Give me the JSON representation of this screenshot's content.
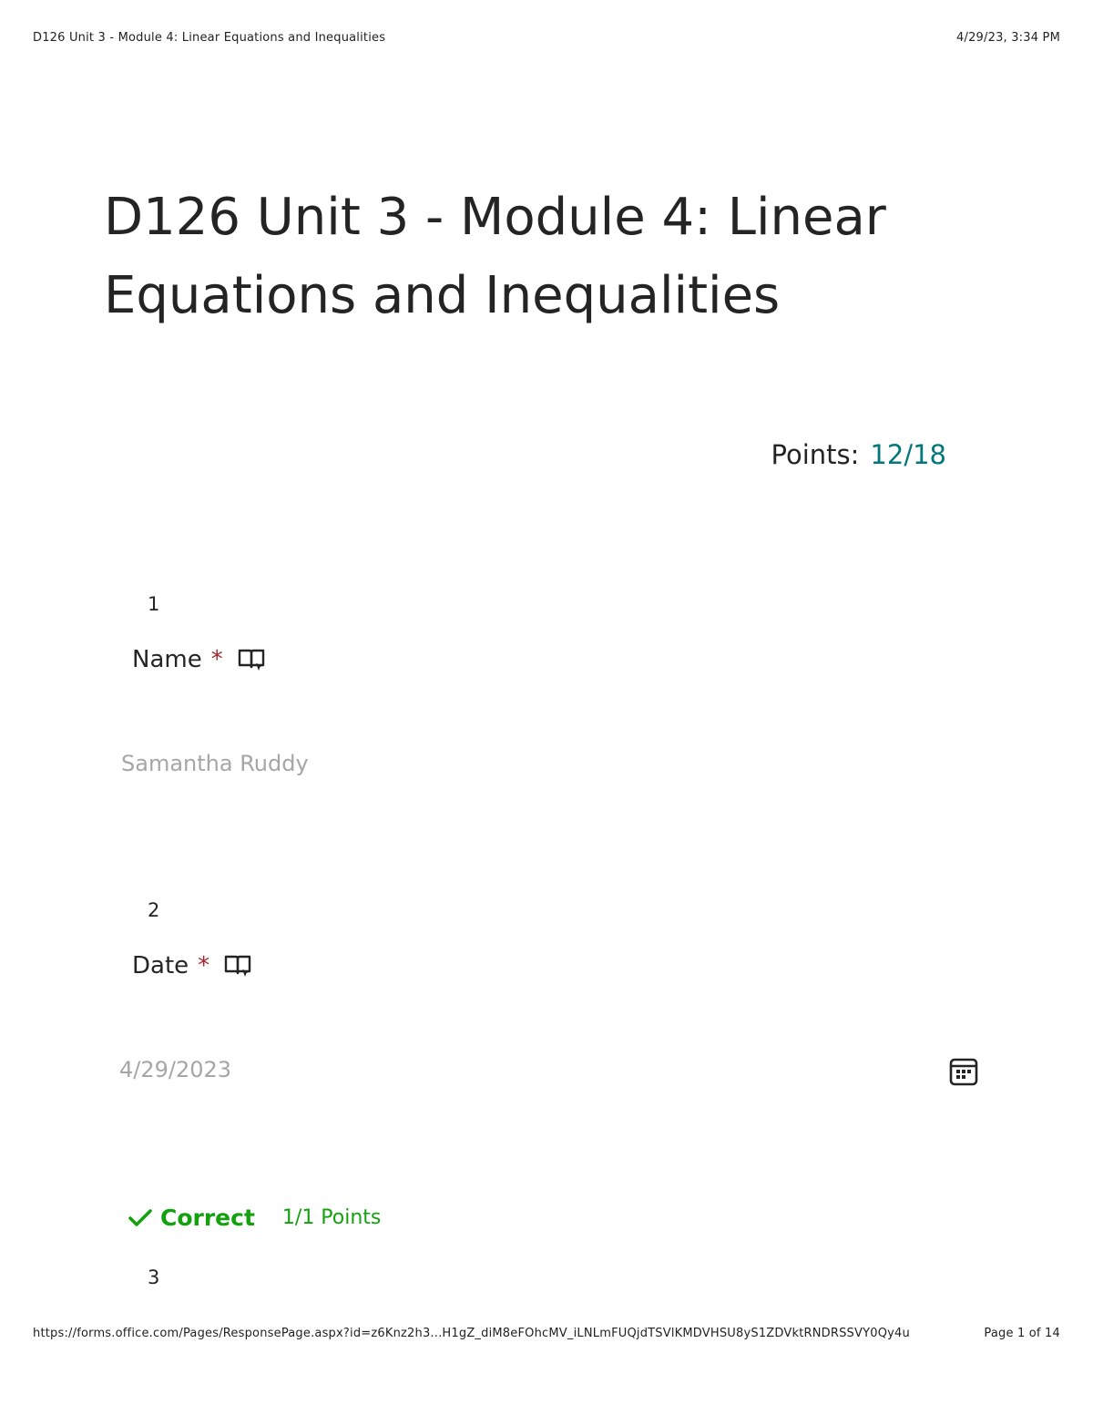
{
  "print_header": {
    "left": "D126 Unit 3 - Module 4: Linear Equations and Inequalities",
    "right": "4/29/23, 3:34 PM"
  },
  "form": {
    "title": "D126 Unit 3 - Module 4: Linear Equations and Inequalities",
    "points_label": "Points:",
    "points_value": "12/18"
  },
  "questions": [
    {
      "number": "1",
      "title": "Name",
      "required_mark": "*",
      "icon": "immersive-reader-icon",
      "answer": "Samantha Ruddy"
    },
    {
      "number": "2",
      "title": "Date",
      "required_mark": "*",
      "icon": "immersive-reader-icon",
      "answer": "4/29/2023",
      "answer_icon": "calendar-icon"
    },
    {
      "number": "3",
      "result_icon": "checkmark-icon",
      "result": "Correct",
      "result_points": "1/1 Points"
    }
  ],
  "print_footer": {
    "url": "https://forms.office.com/Pages/ResponsePage.aspx?id=z6Knz2h3...H1gZ_diM8eFOhcMV_iLNLmFUQjdTSVlKMDVHSU8yS1ZDVktRNDRSSVY0Qy4u",
    "page": "Page 1 of 14"
  },
  "colors": {
    "score": "#03787c",
    "required": "#a4262c",
    "correct": "#13a10e",
    "answer_text": "#a6a6a6"
  }
}
